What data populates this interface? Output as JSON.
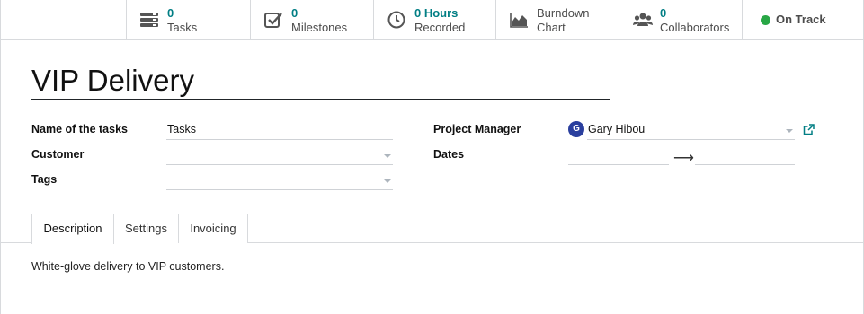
{
  "stats": {
    "tasks": {
      "count": "0",
      "label": "Tasks",
      "icon": "tasks-icon"
    },
    "milestones": {
      "count": "0",
      "label": "Milestones",
      "icon": "check-square-icon"
    },
    "hours": {
      "count": "0 Hours",
      "label": "Recorded",
      "icon": "clock-icon"
    },
    "burndown": {
      "line1": "Burndown",
      "line2": "Chart",
      "icon": "area-chart-icon"
    },
    "collaborators": {
      "count": "0",
      "label": "Collaborators",
      "icon": "users-icon"
    },
    "status": {
      "label": "On Track",
      "color": "#28a745"
    }
  },
  "title": "VIP Delivery",
  "fields": {
    "task_name": {
      "label": "Name of the tasks",
      "value": "Tasks"
    },
    "customer": {
      "label": "Customer",
      "value": ""
    },
    "tags": {
      "label": "Tags",
      "value": ""
    },
    "project_manager": {
      "label": "Project Manager",
      "value": "Gary Hibou",
      "avatar_letter": "G"
    },
    "dates": {
      "label": "Dates",
      "start": "",
      "end": ""
    }
  },
  "tabs": [
    {
      "label": "Description",
      "active": true
    },
    {
      "label": "Settings",
      "active": false
    },
    {
      "label": "Invoicing",
      "active": false
    }
  ],
  "description": "White-glove delivery to VIP customers.",
  "colors": {
    "accent": "#017e84",
    "border": "#d8dadd",
    "avatar": "#2a3f9e"
  }
}
